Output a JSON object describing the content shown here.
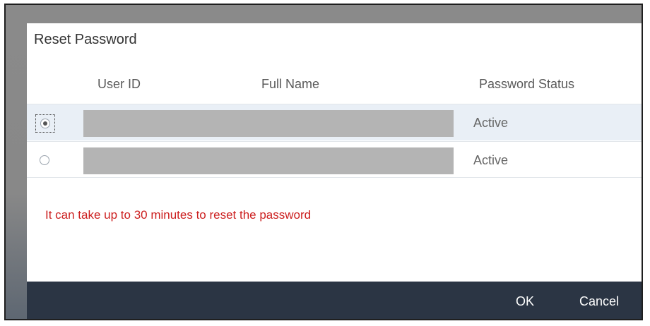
{
  "dialog": {
    "title": "Reset Password"
  },
  "table": {
    "columns": {
      "user_id": "User ID",
      "full_name": "Full Name",
      "password_status": "Password Status"
    },
    "rows": [
      {
        "selected": true,
        "status": "Active"
      },
      {
        "selected": false,
        "status": "Active"
      }
    ]
  },
  "notice": "It can take up to 30 minutes to reset the password",
  "footer": {
    "ok_label": "OK",
    "cancel_label": "Cancel"
  },
  "colors": {
    "notice_text": "#cc1f1f",
    "footer_bg": "#2b3544",
    "selected_row_bg": "#e9eff6"
  }
}
